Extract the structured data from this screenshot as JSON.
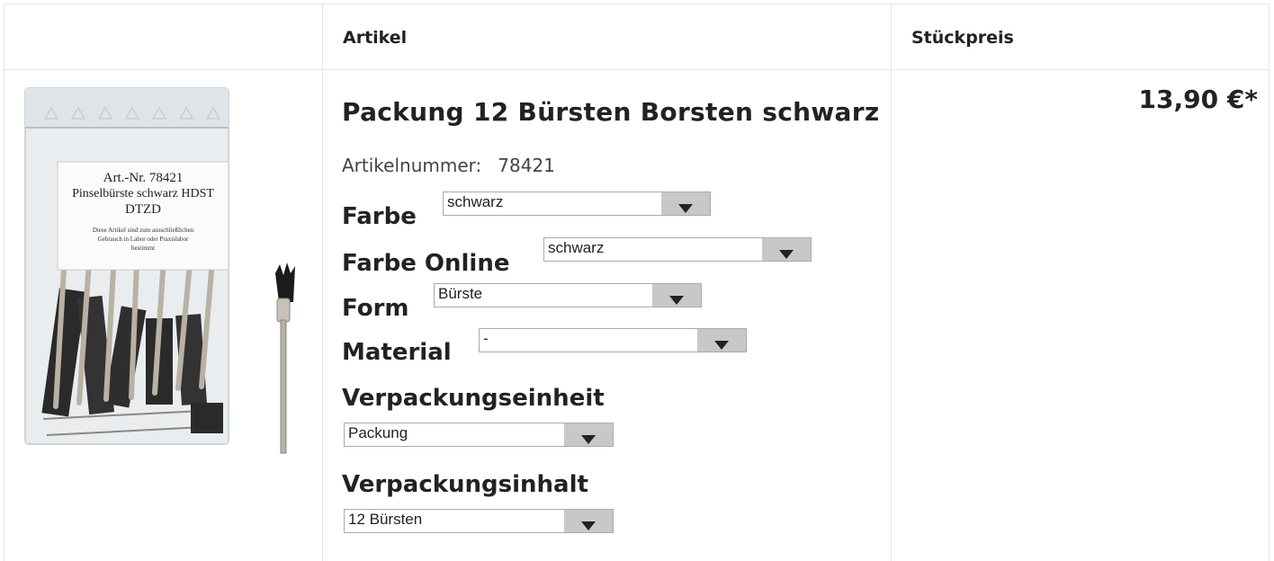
{
  "header": {
    "col_article": "Artikel",
    "col_unit_price": "Stückpreis"
  },
  "product": {
    "title": "Packung 12 Bürsten Borsten schwarz",
    "article_number_label": "Artikelnummer:",
    "article_number": "78421",
    "price": "13,90 €*",
    "image_label": {
      "line1": "Art.-Nr. 78421",
      "line2": "Pinselbürste schwarz HDST",
      "line3": "DTZD",
      "line4": "Diese Artikel sind zum ausschließlichen",
      "line5": "Gebrauch in Labor oder Praxislabor",
      "line6": "bestimmt"
    }
  },
  "options": {
    "farbe": {
      "label": "Farbe",
      "value": "schwarz"
    },
    "farbe_online": {
      "label": "Farbe Online",
      "value": "schwarz"
    },
    "form": {
      "label": "Form",
      "value": "Bürste"
    },
    "material": {
      "label": "Material",
      "value": "-"
    },
    "verpackungseinheit": {
      "label": "Verpackungseinheit",
      "value": "Packung"
    },
    "verpackungsinhalt": {
      "label": "Verpackungsinhalt",
      "value": "12 Bürsten"
    }
  }
}
